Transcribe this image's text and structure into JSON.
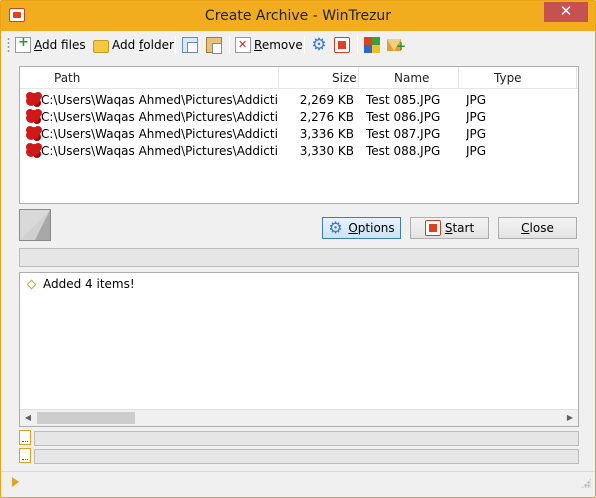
{
  "window": {
    "title": "Create Archive - WinTrezur",
    "close_glyph": "✕"
  },
  "toolbar": {
    "add_files": {
      "prefix": "",
      "accel": "A",
      "rest": "dd files"
    },
    "add_folder": {
      "prefix": "Add ",
      "accel": "f",
      "rest": "older"
    },
    "remove": {
      "prefix": "",
      "accel": "R",
      "rest": "emove"
    }
  },
  "filelist": {
    "columns": {
      "path": "Path",
      "size": "Size",
      "name": "Name",
      "type": "Type"
    },
    "rows": [
      {
        "path": "C:\\Users\\Waqas Ahmed\\Pictures\\Addictive Ti...",
        "size": "2,269 KB",
        "name": "Test 085.JPG",
        "type": "JPG"
      },
      {
        "path": "C:\\Users\\Waqas Ahmed\\Pictures\\Addictive Ti...",
        "size": "2,276 KB",
        "name": "Test 086.JPG",
        "type": "JPG"
      },
      {
        "path": "C:\\Users\\Waqas Ahmed\\Pictures\\Addictive Ti...",
        "size": "3,336 KB",
        "name": "Test 087.JPG",
        "type": "JPG"
      },
      {
        "path": "C:\\Users\\Waqas Ahmed\\Pictures\\Addictive Ti...",
        "size": "3,330 KB",
        "name": "Test 088.JPG",
        "type": "JPG"
      }
    ]
  },
  "buttons": {
    "options": {
      "accel": "O",
      "rest": "ptions"
    },
    "start": {
      "accel": "S",
      "rest": "tart"
    },
    "close": {
      "accel": "C",
      "rest": "lose"
    }
  },
  "log": {
    "lines": [
      "Added 4 items!"
    ]
  },
  "colors": {
    "titlebar": "#f2ad1f",
    "accent": "#e8a020",
    "close_button": "#c75050"
  }
}
